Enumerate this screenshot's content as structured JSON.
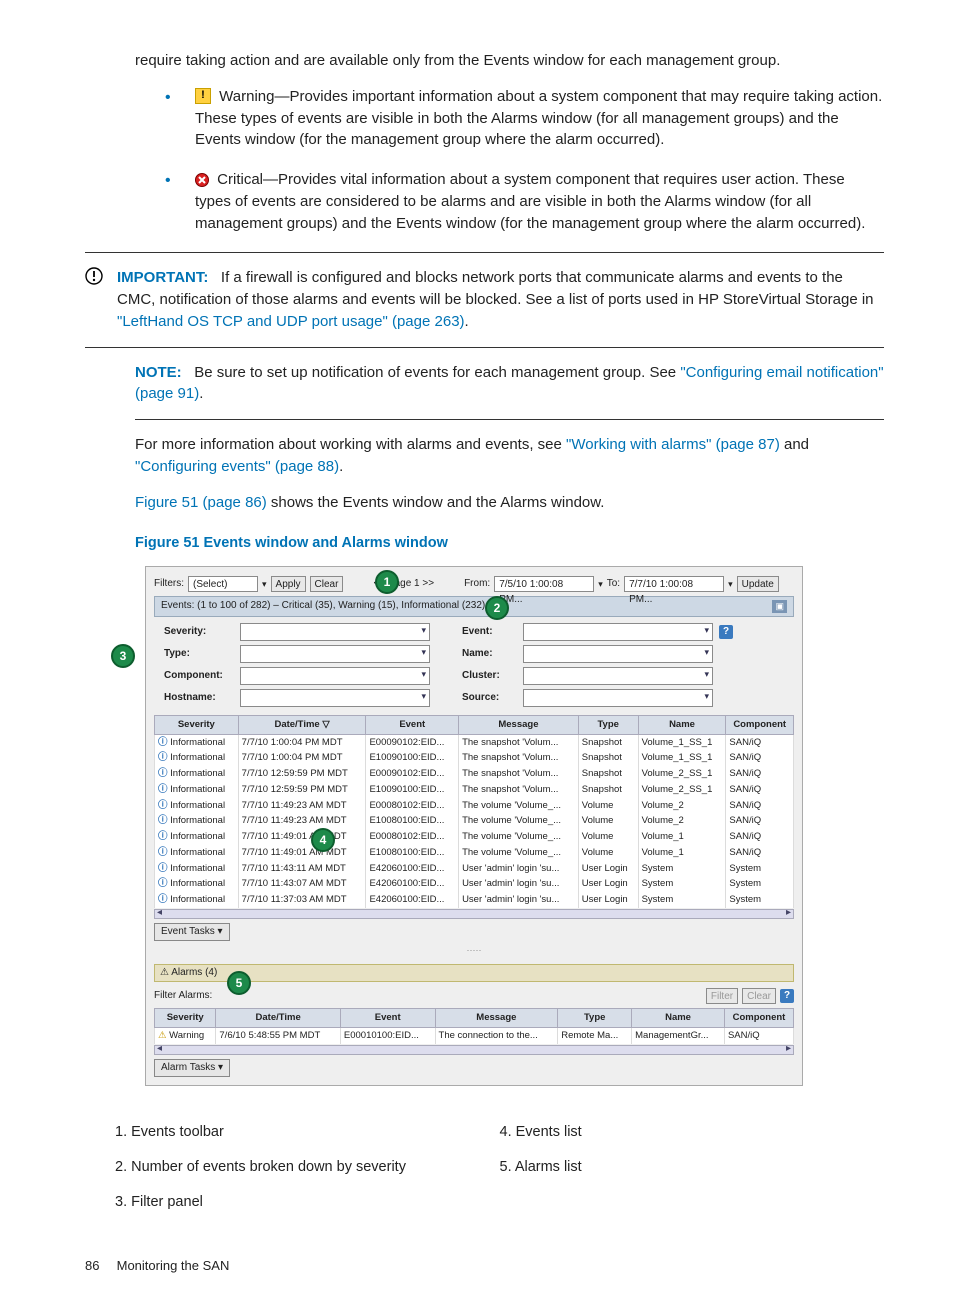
{
  "intro_fragment": "require taking action and are available only from the Events window for each management group.",
  "warning_item": {
    "lead": "Warning—Provides important information about a system component that may require taking action. These types of events are visible in both the Alarms window (for all management groups) and the Events window (for the management group where the alarm occurred)."
  },
  "critical_item": {
    "lead": "Critical—Provides vital information about a system component that requires user action. These types of events are considered to be alarms and are visible in both the Alarms window (for all management groups) and the Events window (for the management group where the alarm occurred)."
  },
  "important": {
    "label": "IMPORTANT:",
    "text_a": "If a firewall is configured and blocks network ports that communicate alarms and events to the CMC, notification of those alarms and events will be blocked. See a list of ports used in HP StoreVirtual Storage in ",
    "link": "\"LeftHand OS TCP and UDP port usage\" (page 263)",
    "text_b": "."
  },
  "note": {
    "label": "NOTE:",
    "text_a": "Be sure to set up notification of events for each management group. See ",
    "link": "\"Configuring email notification\" (page 91)",
    "text_b": "."
  },
  "more_info": {
    "text_a": "For more information about working with alarms and events, see ",
    "link1": "\"Working with alarms\" (page 87)",
    "mid": " and ",
    "link2": "\"Configuring events\" (page 88)",
    "text_b": "."
  },
  "fig_ref": {
    "link": "Figure 51 (page 86)",
    "rest": " shows the Events window and the Alarms window."
  },
  "figure_title": "Figure 51 Events window and Alarms window",
  "screenshot": {
    "filters_label": "Filters:",
    "filters_value": "(Select)",
    "apply": "Apply",
    "clear": "Clear",
    "page_nav": "<< Page 1 >>",
    "from_label": "From:",
    "from_value": "7/5/10 1:00:08 PM...",
    "to_label": "To:",
    "to_value": "7/7/10 1:00:08 PM...",
    "update": "Update",
    "summary": "Events: (1 to 100 of 282) – Critical (35), Warning (15), Informational (232)",
    "filter_labels": {
      "severity": "Severity:",
      "type": "Type:",
      "component": "Component:",
      "hostname": "Hostname:",
      "event": "Event:",
      "name": "Name:",
      "cluster": "Cluster:",
      "source": "Source:"
    },
    "columns": [
      "Severity",
      "Date/Time ▽",
      "Event",
      "Message",
      "Type",
      "Name",
      "Component"
    ],
    "rows": [
      {
        "sev": "Informational",
        "dt": "7/7/10 1:00:04 PM MDT",
        "ev": "E00090102:EID...",
        "msg": "The snapshot 'Volum...",
        "type": "Snapshot",
        "name": "Volume_1_SS_1",
        "comp": "SAN/iQ"
      },
      {
        "sev": "Informational",
        "dt": "7/7/10 1:00:04 PM MDT",
        "ev": "E10090100:EID...",
        "msg": "The snapshot 'Volum...",
        "type": "Snapshot",
        "name": "Volume_1_SS_1",
        "comp": "SAN/iQ"
      },
      {
        "sev": "Informational",
        "dt": "7/7/10 12:59:59 PM MDT",
        "ev": "E00090102:EID...",
        "msg": "The snapshot 'Volum...",
        "type": "Snapshot",
        "name": "Volume_2_SS_1",
        "comp": "SAN/iQ"
      },
      {
        "sev": "Informational",
        "dt": "7/7/10 12:59:59 PM MDT",
        "ev": "E10090100:EID...",
        "msg": "The snapshot 'Volum...",
        "type": "Snapshot",
        "name": "Volume_2_SS_1",
        "comp": "SAN/iQ"
      },
      {
        "sev": "Informational",
        "dt": "7/7/10 11:49:23 AM MDT",
        "ev": "E00080102:EID...",
        "msg": "The volume 'Volume_...",
        "type": "Volume",
        "name": "Volume_2",
        "comp": "SAN/iQ"
      },
      {
        "sev": "Informational",
        "dt": "7/7/10 11:49:23 AM MDT",
        "ev": "E10080100:EID...",
        "msg": "The volume 'Volume_...",
        "type": "Volume",
        "name": "Volume_2",
        "comp": "SAN/iQ"
      },
      {
        "sev": "Informational",
        "dt": "7/7/10 11:49:01 AM MDT",
        "ev": "E00080102:EID...",
        "msg": "The volume 'Volume_...",
        "type": "Volume",
        "name": "Volume_1",
        "comp": "SAN/iQ"
      },
      {
        "sev": "Informational",
        "dt": "7/7/10 11:49:01 AM MDT",
        "ev": "E10080100:EID...",
        "msg": "The volume 'Volume_...",
        "type": "Volume",
        "name": "Volume_1",
        "comp": "SAN/iQ"
      },
      {
        "sev": "Informational",
        "dt": "7/7/10 11:43:11 AM MDT",
        "ev": "E42060100:EID...",
        "msg": "User 'admin' login 'su...",
        "type": "User Login",
        "name": "System",
        "comp": "System"
      },
      {
        "sev": "Informational",
        "dt": "7/7/10 11:43:07 AM MDT",
        "ev": "E42060100:EID...",
        "msg": "User 'admin' login 'su...",
        "type": "User Login",
        "name": "System",
        "comp": "System"
      },
      {
        "sev": "Informational",
        "dt": "7/7/10 11:37:03 AM MDT",
        "ev": "E42060100:EID...",
        "msg": "User 'admin' login 'su...",
        "type": "User Login",
        "name": "System",
        "comp": "System"
      }
    ],
    "event_tasks": "Event Tasks ▾",
    "alarms_header": "⚠ Alarms (4)",
    "filter_alarms": "Filter Alarms:",
    "filter_btn": "Filter",
    "clear_btn": "Clear",
    "alarm_columns": [
      "Severity",
      "Date/Time",
      "Event",
      "Message",
      "Type",
      "Name",
      "Component"
    ],
    "alarm_row": {
      "sev": "Warning",
      "dt": "7/6/10 5:48:55 PM MDT",
      "ev": "E00010100:EID...",
      "msg": "The connection to the...",
      "type": "Remote Ma...",
      "name": "ManagementGr...",
      "comp": "SAN/iQ"
    },
    "alarm_tasks": "Alarm Tasks ▾"
  },
  "legend": {
    "l1": "1. Events toolbar",
    "l2": "2. Number of events broken down by severity",
    "l3": "3. Filter panel",
    "r4": "4. Events list",
    "r5": "5. Alarms list"
  },
  "footer": {
    "page": "86",
    "title": "Monitoring the SAN"
  }
}
